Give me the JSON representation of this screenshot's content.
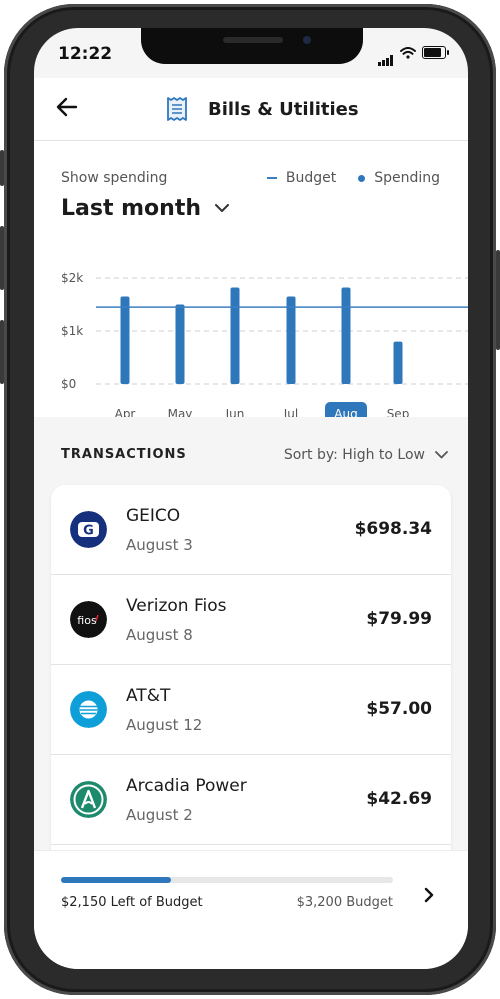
{
  "status_bar": {
    "time": "12:22"
  },
  "header": {
    "title": "Bills & Utilities",
    "icon": "receipt-icon"
  },
  "chart_section": {
    "show_label": "Show spending",
    "period": "Last month",
    "legend": {
      "budget": "Budget",
      "spending": "Spending"
    }
  },
  "chart_data": {
    "type": "bar",
    "categories": [
      "Apr",
      "May",
      "Jun",
      "Jul",
      "Aug",
      "Sep"
    ],
    "series": [
      {
        "name": "Spending",
        "values": [
          1650,
          1500,
          1820,
          1650,
          1820,
          800
        ]
      }
    ],
    "budget": 1450,
    "yticks": [
      {
        "value": 0,
        "label": "$0"
      },
      {
        "value": 1000,
        "label": "$1k"
      },
      {
        "value": 2000,
        "label": "$2k"
      }
    ],
    "ylim": [
      0,
      2000
    ],
    "selected": "Aug",
    "grid": true,
    "colors": {
      "bar": "#2f77bb",
      "budget_line": "#3b7ec0",
      "selected_bg": "#2f77bb"
    }
  },
  "transactions": {
    "heading": "TRANSACTIONS",
    "sort_label": "Sort by: High to Low",
    "items": [
      {
        "merchant": "GEICO",
        "date": "August 3",
        "amount": "$698.34",
        "logo": "geico-logo-icon",
        "logo_text": "G",
        "color": "#15317e"
      },
      {
        "merchant": "Verizon Fios",
        "date": "August 8",
        "amount": "$79.99",
        "logo": "fios-logo-icon",
        "logo_text": "fios",
        "color": "#111111"
      },
      {
        "merchant": "AT&T",
        "date": "August 12",
        "amount": "$57.00",
        "logo": "att-logo-icon",
        "logo_text": "",
        "color": "#0e9fd8"
      },
      {
        "merchant": "Arcadia Power",
        "date": "August 2",
        "amount": "$42.69",
        "logo": "arcadia-logo-icon",
        "logo_text": "",
        "color": "#1d8a6b"
      }
    ]
  },
  "budget_footer": {
    "left_label": "$2,150 Left of Budget",
    "total_label": "$3,200 Budget",
    "progress": 0.33
  }
}
